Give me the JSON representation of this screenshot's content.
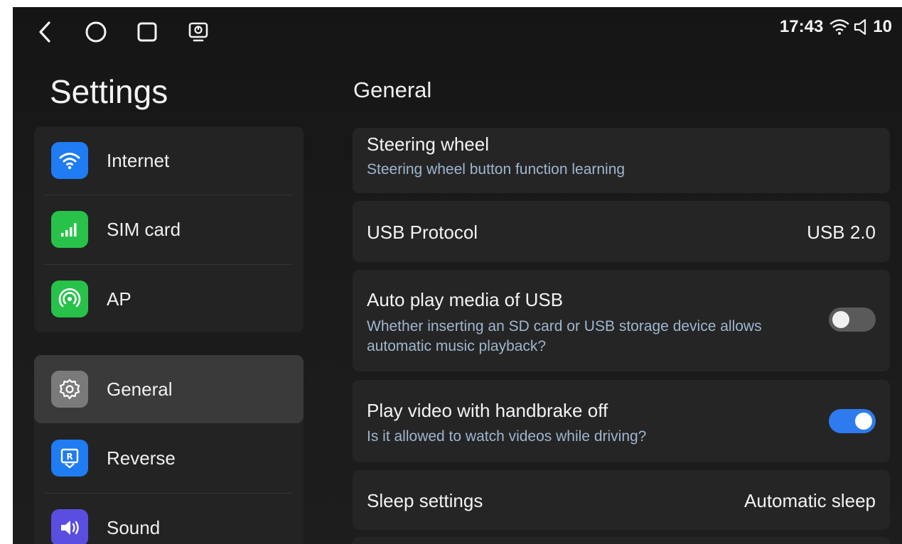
{
  "status_bar": {
    "time": "17:43",
    "volume": "10",
    "icons": [
      "back-icon",
      "home-icon",
      "recents-icon",
      "screen-cast-icon",
      "wifi-icon",
      "speaker-icon"
    ]
  },
  "sidebar": {
    "title": "Settings",
    "items": [
      {
        "label": "Internet",
        "icon": "wifi-icon",
        "color": "#1f7cf2"
      },
      {
        "label": "SIM card",
        "icon": "signal-bars-icon",
        "color": "#28c24a"
      },
      {
        "label": "AP",
        "icon": "hotspot-icon",
        "color": "#28c24a"
      },
      {
        "label": "General",
        "icon": "gear-icon",
        "color": "#7a7a7a",
        "active": true
      },
      {
        "label": "Reverse",
        "icon": "reverse-camera-icon",
        "color": "#1f7cf2"
      },
      {
        "label": "Sound",
        "icon": "speaker-icon",
        "color": "#5a4ee0"
      }
    ]
  },
  "main": {
    "title": "General",
    "items": [
      {
        "title": "Steering wheel",
        "subtitle": "Steering wheel button function learning"
      },
      {
        "title": "USB Protocol",
        "value": "USB 2.0"
      },
      {
        "title": "Auto play media of USB",
        "subtitle": "Whether inserting an SD card or USB storage device allows automatic music playback?",
        "toggle": "off"
      },
      {
        "title": "Play video with handbrake off",
        "subtitle": "Is it allowed to watch videos while driving?",
        "toggle": "on"
      },
      {
        "title": "Sleep settings",
        "value": "Automatic sleep"
      }
    ]
  }
}
